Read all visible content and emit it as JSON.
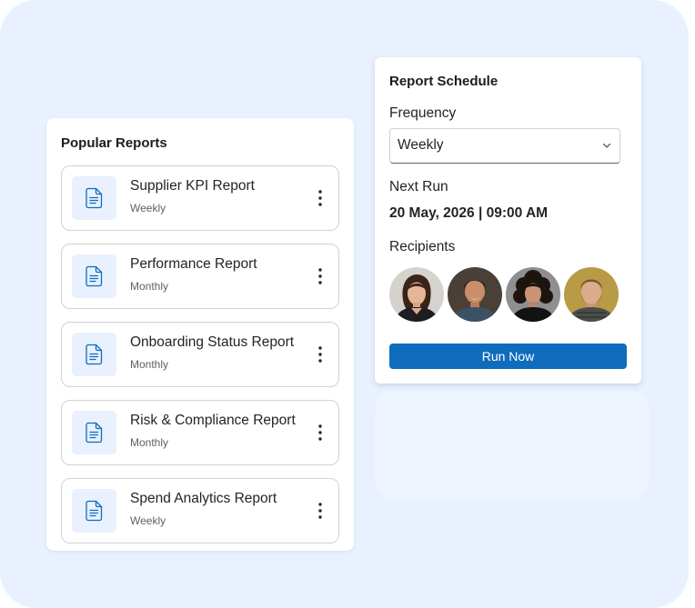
{
  "popular_reports": {
    "title": "Popular Reports",
    "items": [
      {
        "name": "Supplier KPI Report",
        "frequency": "Weekly"
      },
      {
        "name": "Performance Report",
        "frequency": "Monthly"
      },
      {
        "name": "Onboarding Status Report",
        "frequency": "Monthly"
      },
      {
        "name": "Risk & Compliance Report",
        "frequency": "Monthly"
      },
      {
        "name": "Spend Analytics Report",
        "frequency": "Weekly"
      }
    ]
  },
  "schedule": {
    "title": "Report Schedule",
    "frequency_label": "Frequency",
    "frequency_value": "Weekly",
    "next_run_label": "Next Run",
    "next_run_value": "20 May, 2026 | 09:00 AM",
    "recipients_label": "Recipients",
    "recipients_count": 4,
    "run_button": "Run Now"
  },
  "icons": {
    "report_item": "document-icon",
    "report_menu": "more-vertical-icon",
    "select": "chevron-down-icon"
  },
  "colors": {
    "background": "#e8f1fd",
    "accent": "#0f6cbd",
    "icon_blue": "#0f6cbd"
  }
}
